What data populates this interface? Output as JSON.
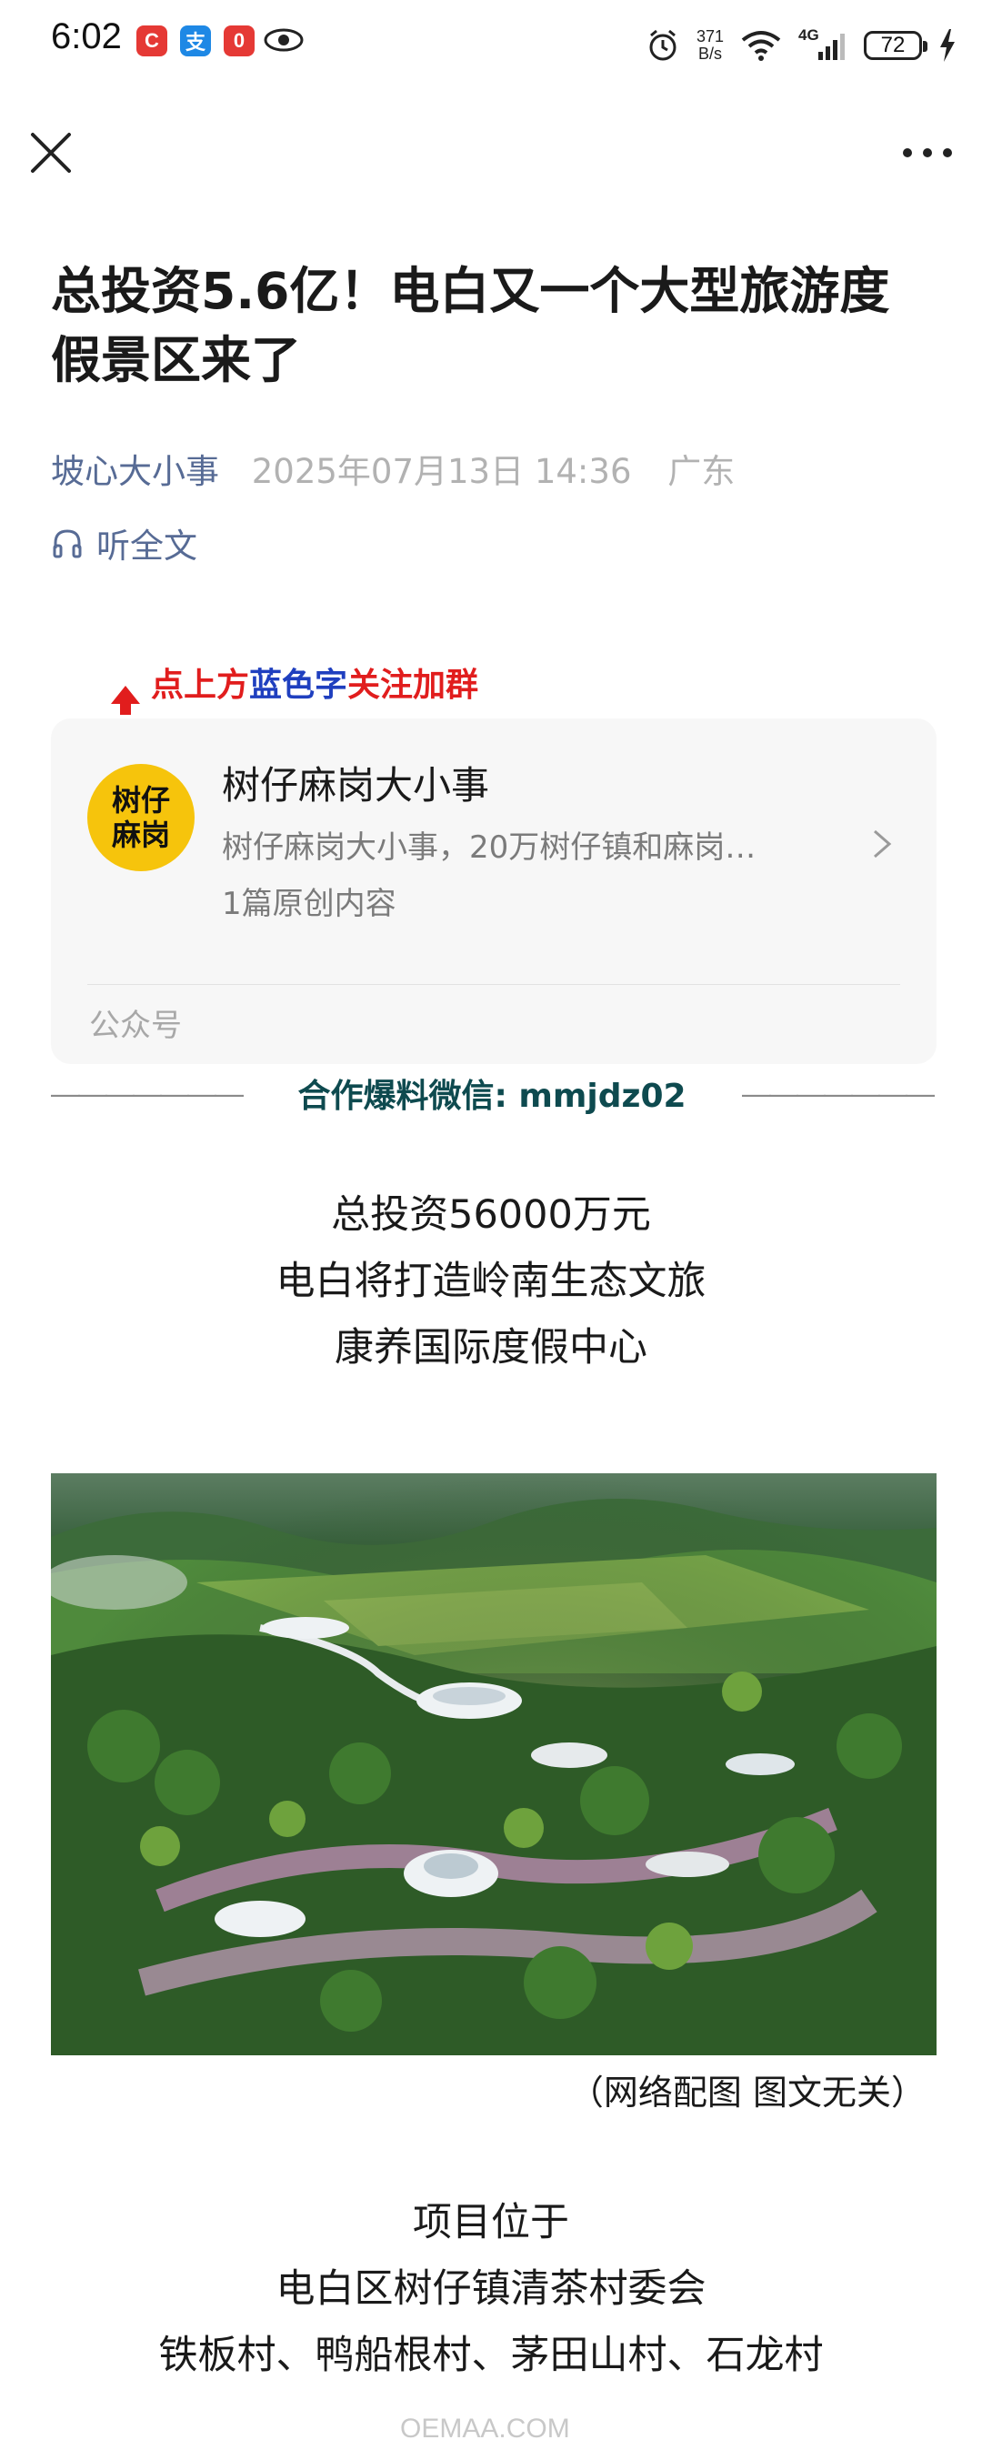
{
  "status_bar": {
    "time": "6:02",
    "net_speed_value": "371",
    "net_speed_unit": "B/s",
    "network": "4G",
    "battery": "72",
    "app_icons": [
      {
        "name": "c-app",
        "glyph": "C",
        "color": "#e53935"
      },
      {
        "name": "alipay-app",
        "glyph": "支",
        "color": "#1e88e5"
      },
      {
        "name": "notification-app",
        "glyph": "0",
        "color": "#e53935"
      }
    ]
  },
  "article": {
    "title": "总投资5.6亿！电白又一个大型旅游度假景区来了",
    "author": "坡心大小事",
    "date": "2025年07月13日 14:36",
    "location": "广东",
    "listen_label": "听全文"
  },
  "follow_banner": {
    "segments": [
      {
        "text": "点上方",
        "color": "#e11d1d"
      },
      {
        "text": "蓝色字",
        "color": "#1f3fbf"
      },
      {
        "text": "关注加群",
        "color": "#e11d1d"
      }
    ]
  },
  "account_card": {
    "avatar_text_line1": "树仔",
    "avatar_text_line2": "麻岗",
    "name": "树仔麻岗大小事",
    "description": "树仔麻岗大小事，20万树仔镇和麻岗…",
    "original_count": "1篇原创内容",
    "type_label": "公众号"
  },
  "contact": {
    "dashes": "———————",
    "text": "合作爆料微信: mmjdz02"
  },
  "intro": {
    "line1": "总投资56000万元",
    "line2": "电白将打造岭南生态文旅",
    "line3": "康养国际度假中心"
  },
  "image_caption": "（网络配图 图文无关）",
  "location_block": {
    "line1": "项目位于",
    "line2": "电白区树仔镇清茶村委会",
    "line3": "铁板村、鸭船根村、茅田山村、石龙村"
  },
  "watermark": "OEMAA.COM"
}
